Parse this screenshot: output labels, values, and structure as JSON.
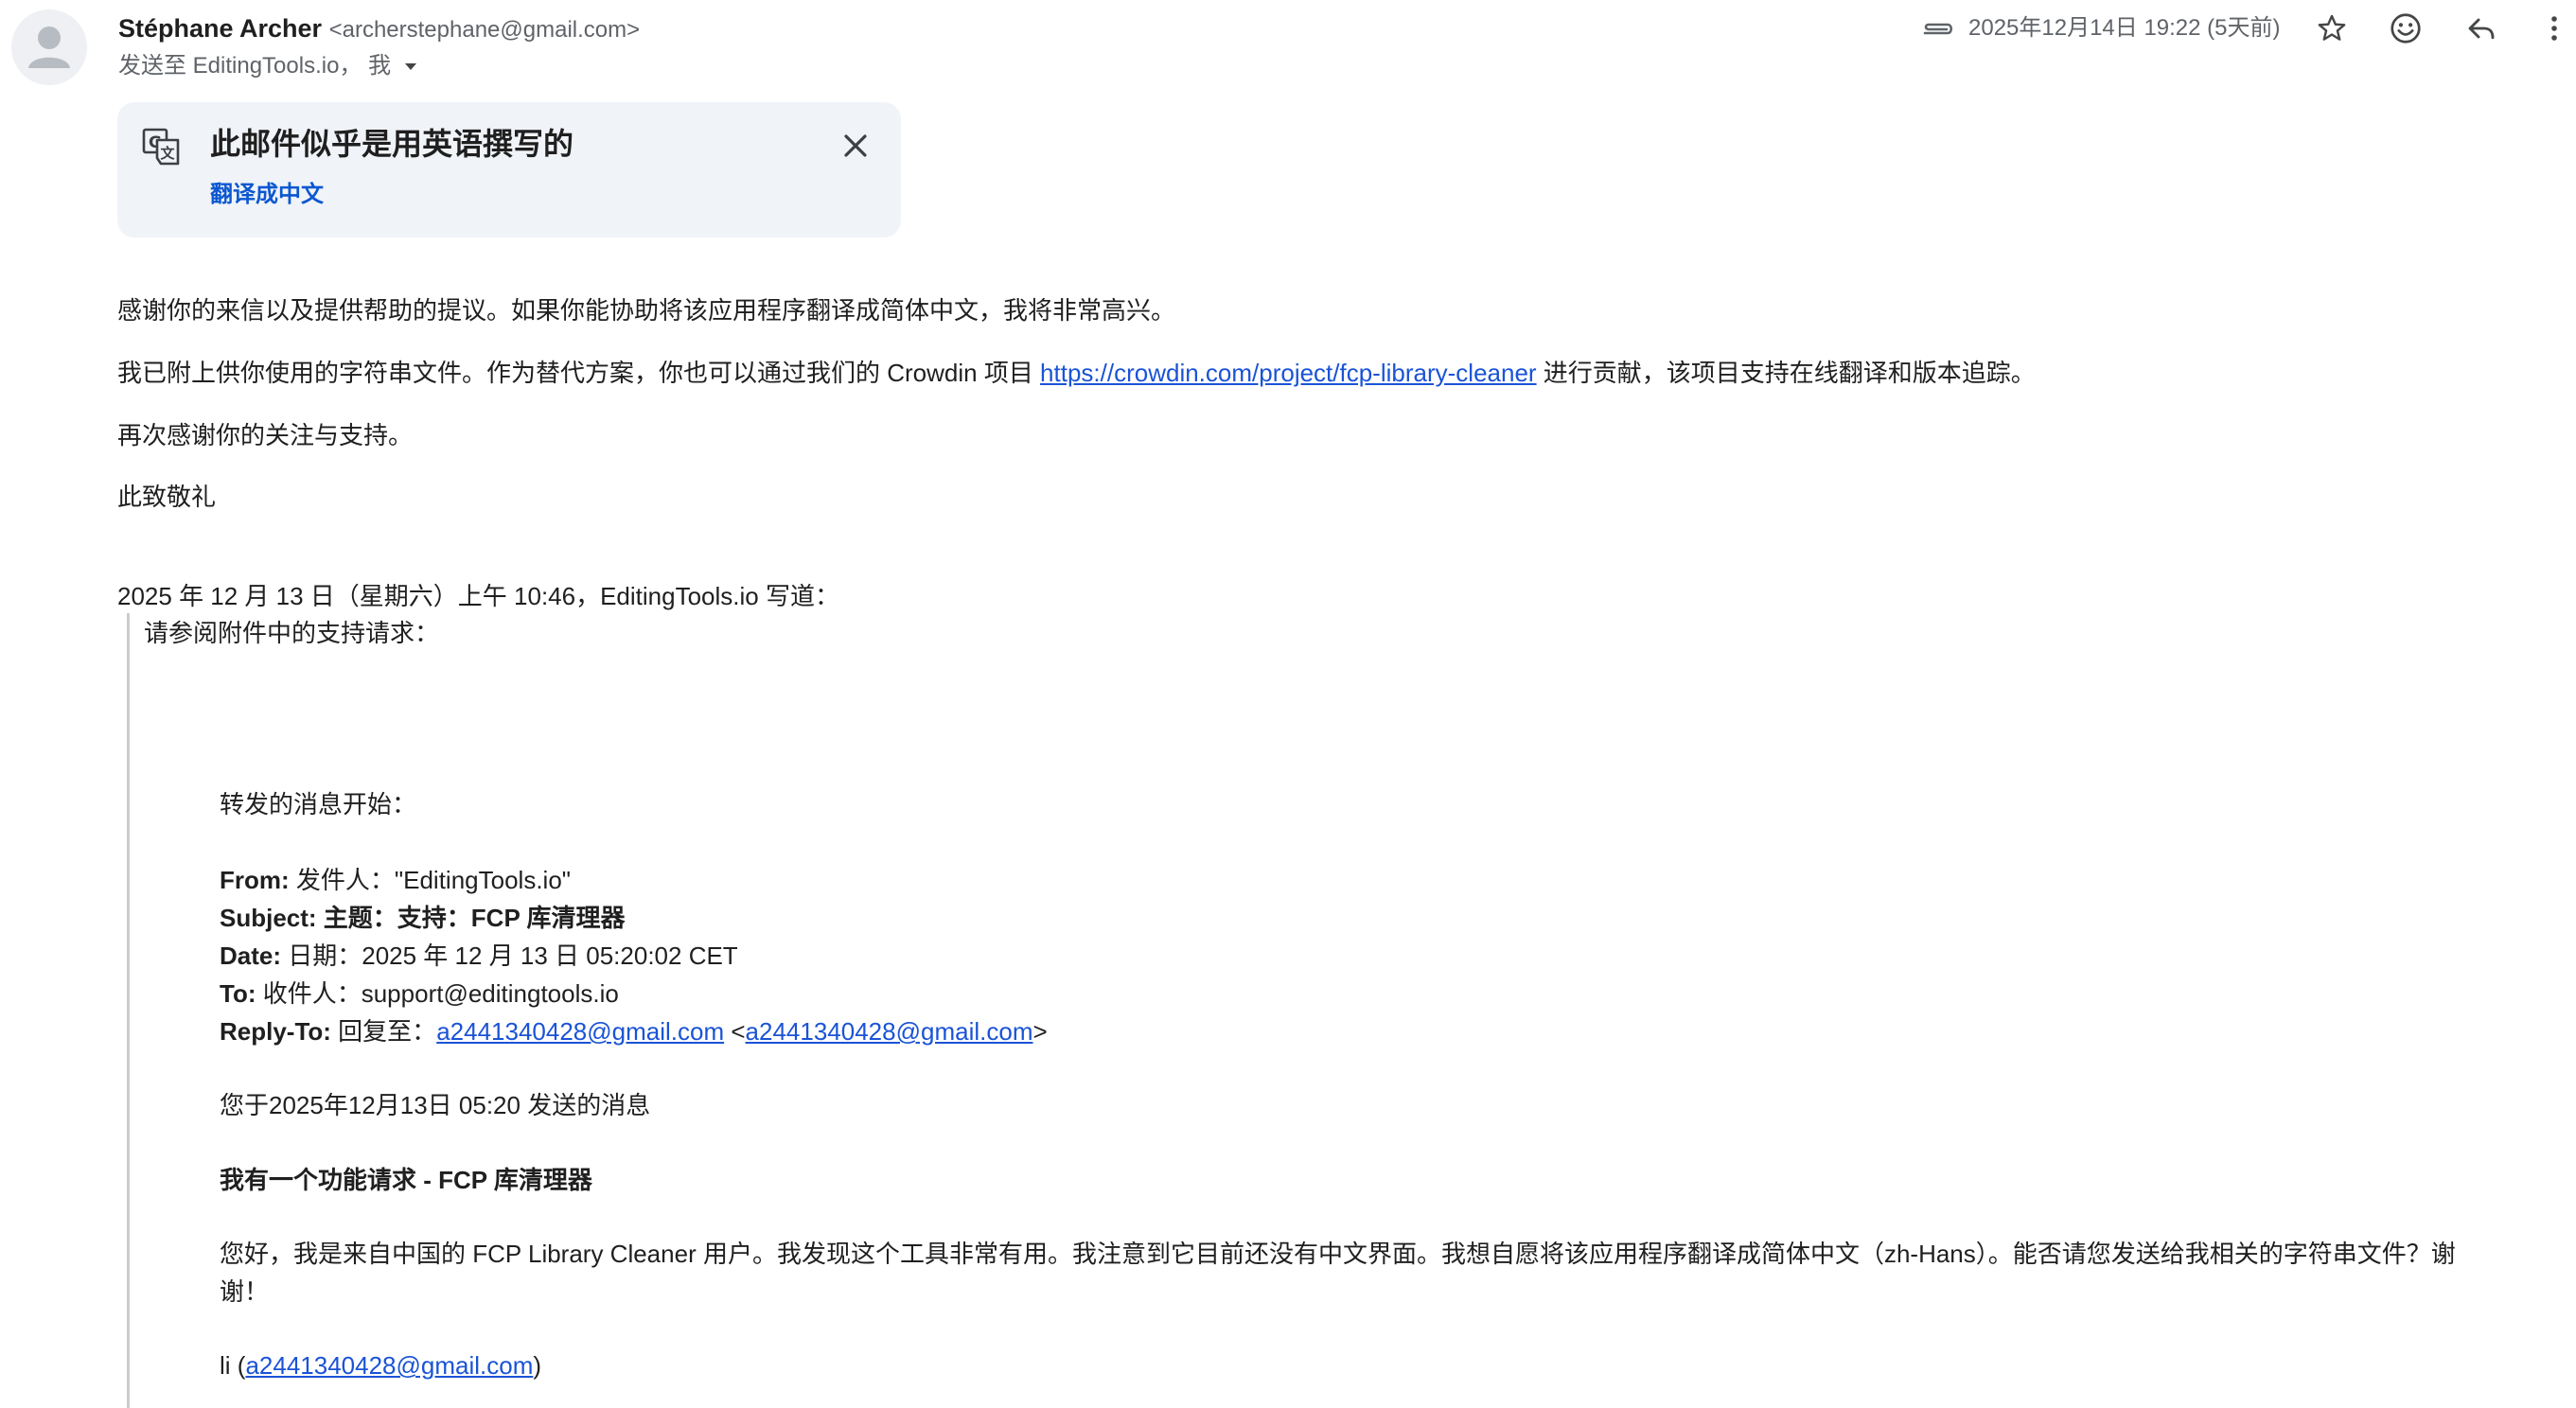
{
  "sender": {
    "name": "Stéphane Archer",
    "email": "<archerstephane@gmail.com>",
    "recipients": "发送至 EditingTools.io， 我"
  },
  "meta": {
    "timestamp": "2025年12月14日 19:22 (5天前)"
  },
  "icons": {
    "avatar": "person-avatar",
    "attachment": "paperclip-icon",
    "star": "star-icon",
    "emoji": "emoji-icon",
    "reply": "reply-icon",
    "more": "more-vert-icon",
    "translate": "translate-icon",
    "close": "close-icon",
    "details": "chevron-down-icon"
  },
  "translate_banner": {
    "title": "此邮件似乎是用英语撰写的",
    "action": "翻译成中文"
  },
  "body": {
    "p1": "感谢你的来信以及提供帮助的提议。如果你能协助将该应用程序翻译成简体中文，我将非常高兴。",
    "p2_before": "我已附上供你使用的字符串文件。作为替代方案，你也可以通过我们的 Crowdin 项目 ",
    "p2_link": "https://crowdin.com/project/fcp-library-cleaner",
    "p2_after": " 进行贡献，该项目支持在线翻译和版本追踪。",
    "p3": "再次感谢你的关注与支持。",
    "p4": "此致敬礼"
  },
  "quote": {
    "attribution": "2025 年 12 月 13 日（星期六）上午 10:46，EditingTools.io 写道：",
    "line1": "请参阅附件中的支持请求：",
    "forwarded": {
      "header": "转发的消息开始：",
      "from_label": "From:",
      "from_value": " 发件人：\"EditingTools.io\"",
      "subject_label": "Subject:",
      "subject_value": " 主题：支持：FCP 库清理器",
      "date_label": "Date:",
      "date_value": " 日期：2025 年 12 月 13 日 05:20:02 CET",
      "to_label": "To:",
      "to_value": " 收件人：support@editingtools.io",
      "replyto_label": "Reply-To:",
      "replyto_prefix": " 回复至：",
      "replyto_link1": "a2441340428@gmail.com",
      "replyto_lt": " <",
      "replyto_link2": "a2441340428@gmail.com",
      "replyto_gt": ">",
      "sent_note": "您于2025年12月13日 05:20 发送的消息",
      "request_title": "我有一个功能请求 - FCP 库清理器",
      "request_body": "您好，我是来自中国的 FCP Library Cleaner 用户。我发现这个工具非常有用。我注意到它目前还没有中文界面。我想自愿将该应用程序翻译成简体中文（zh-Hans）。能否请您发送给我相关的字符串文件？谢谢！",
      "sig_prefix": "li (",
      "sig_link": "a2441340428@gmail.com",
      "sig_suffix": ")"
    }
  }
}
